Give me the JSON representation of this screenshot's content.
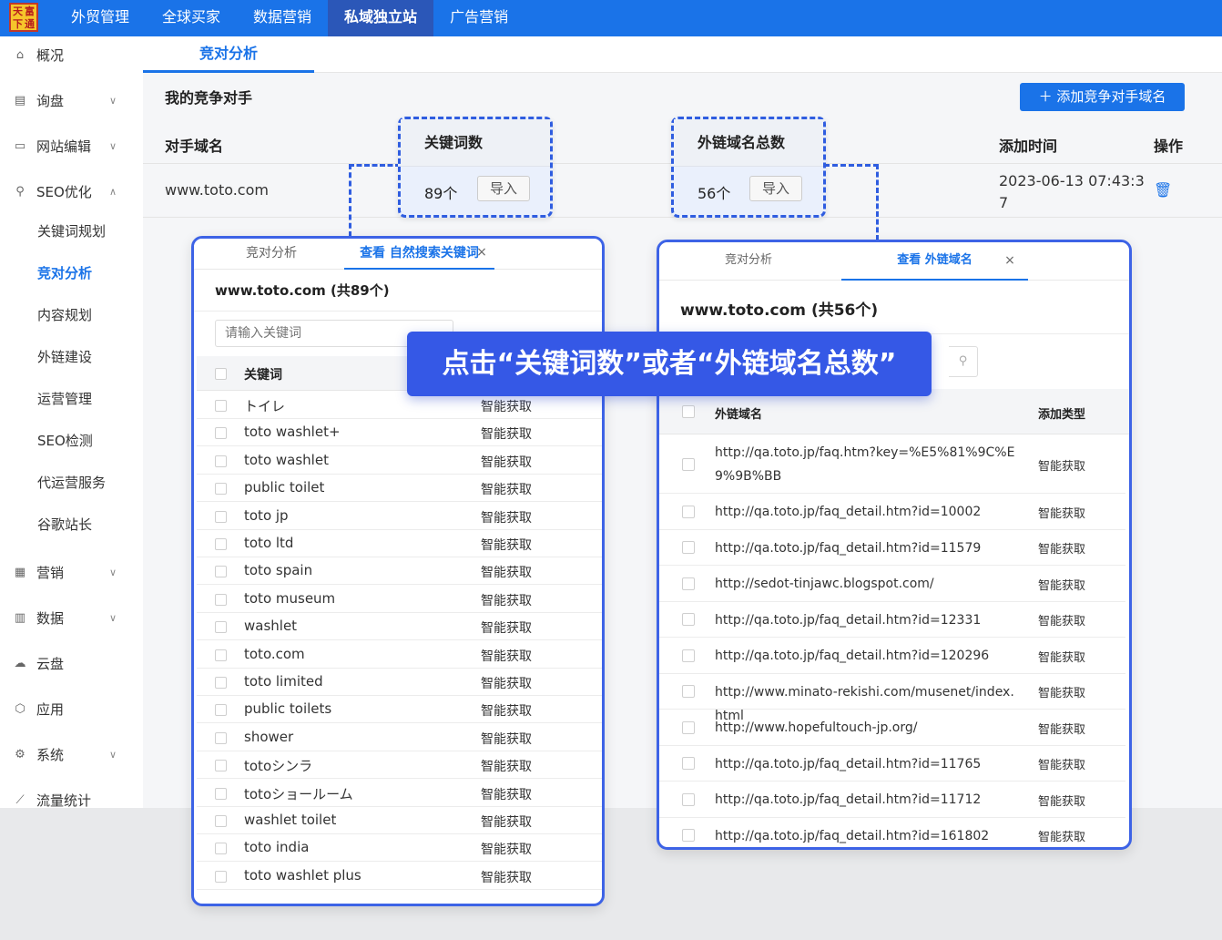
{
  "topbar": {
    "logo_chars": [
      "天",
      "富",
      "下",
      "通"
    ],
    "tabs": [
      {
        "label": "外贸管理",
        "active": false
      },
      {
        "label": "全球买家",
        "active": false
      },
      {
        "label": "数据营销",
        "active": false
      },
      {
        "label": "私域独立站",
        "active": true
      },
      {
        "label": "广告营销",
        "active": false
      }
    ]
  },
  "sidebar": {
    "items": [
      {
        "label": "概况",
        "icon": "home-icon",
        "glyph": "⌂"
      },
      {
        "label": "询盘",
        "icon": "clipboard-icon",
        "glyph": "▤",
        "chevron": "∨"
      },
      {
        "label": "网站编辑",
        "icon": "monitor-icon",
        "glyph": "▭",
        "chevron": "∨"
      },
      {
        "label": "SEO优化",
        "icon": "search-icon",
        "glyph": "⚲",
        "chevron": "∧"
      },
      {
        "label": "营销",
        "icon": "marketing-icon",
        "glyph": "▦",
        "chevron": "∨"
      },
      {
        "label": "数据",
        "icon": "data-icon",
        "glyph": "▥",
        "chevron": "∨"
      },
      {
        "label": "云盘",
        "icon": "cloud-icon",
        "glyph": "☁"
      },
      {
        "label": "应用",
        "icon": "app-icon",
        "glyph": "⬡"
      },
      {
        "label": "系统",
        "icon": "settings-icon",
        "glyph": "⚙",
        "chevron": "∨"
      },
      {
        "label": "流量统计",
        "icon": "chart-icon",
        "glyph": "⟋"
      }
    ],
    "sub_items": [
      {
        "label": "关键词规划",
        "active": false
      },
      {
        "label": "竞对分析",
        "active": true
      },
      {
        "label": "内容规划",
        "active": false
      },
      {
        "label": "外链建设",
        "active": false
      },
      {
        "label": "运营管理",
        "active": false
      },
      {
        "label": "SEO检测",
        "active": false
      },
      {
        "label": "代运营服务",
        "active": false
      },
      {
        "label": "谷歌站长",
        "active": false
      }
    ]
  },
  "main": {
    "tab": "竞对分析",
    "title": "我的竞争对手",
    "add_button": "添加竞争对手域名",
    "add_glyph": "＋",
    "columns": {
      "domain": "对手域名",
      "added_time": "添加时间",
      "actions": "操作"
    },
    "row": {
      "domain": "www.toto.com",
      "added_time": "2023-06-13 07:43:37",
      "trash_glyph": "🗑"
    }
  },
  "callouts": {
    "keywords": {
      "header": "关键词数",
      "value": "89个",
      "import_label": "导入"
    },
    "backlinks": {
      "header": "外链域名总数",
      "value": "56个",
      "import_label": "导入"
    }
  },
  "keyword_panel": {
    "tabs": [
      "竞对分析",
      "查看 自然搜索关键词"
    ],
    "close_glyph": "×",
    "title": "www.toto.com (共89个)",
    "search_placeholder": "请输入关键词",
    "columns": {
      "keyword": "关键词"
    },
    "rows": [
      {
        "keyword": "トイレ",
        "source": "智能获取"
      },
      {
        "keyword": "toto washlet+",
        "source": "智能获取"
      },
      {
        "keyword": "toto washlet",
        "source": "智能获取"
      },
      {
        "keyword": "public toilet",
        "source": "智能获取"
      },
      {
        "keyword": "toto jp",
        "source": "智能获取"
      },
      {
        "keyword": "toto ltd",
        "source": "智能获取"
      },
      {
        "keyword": "toto spain",
        "source": "智能获取"
      },
      {
        "keyword": "toto museum",
        "source": "智能获取"
      },
      {
        "keyword": "washlet",
        "source": "智能获取"
      },
      {
        "keyword": "toto.com",
        "source": "智能获取"
      },
      {
        "keyword": "toto limited",
        "source": "智能获取"
      },
      {
        "keyword": "public toilets",
        "source": "智能获取"
      },
      {
        "keyword": "shower",
        "source": "智能获取"
      },
      {
        "keyword": "totoシンラ",
        "source": "智能获取"
      },
      {
        "keyword": "totoショールーム",
        "source": "智能获取"
      },
      {
        "keyword": "washlet toilet",
        "source": "智能获取"
      },
      {
        "keyword": "toto india",
        "source": "智能获取"
      },
      {
        "keyword": "toto washlet plus",
        "source": "智能获取"
      }
    ]
  },
  "backlink_panel": {
    "tabs": [
      "竞对分析",
      "查看 外链域名"
    ],
    "close_glyph": "×",
    "title": "www.toto.com (共56个)",
    "columns": {
      "domain": "外链域名",
      "type": "添加类型"
    },
    "rows": [
      {
        "url": "http://qa.toto.jp/faq.htm?key=%E5%81%9C%E9%9B%BB",
        "type": "智能获取"
      },
      {
        "url": "http://qa.toto.jp/faq_detail.htm?id=10002",
        "type": "智能获取"
      },
      {
        "url": "http://qa.toto.jp/faq_detail.htm?id=11579",
        "type": "智能获取"
      },
      {
        "url": "http://sedot-tinjawc.blogspot.com/",
        "type": "智能获取"
      },
      {
        "url": "http://qa.toto.jp/faq_detail.htm?id=12331",
        "type": "智能获取"
      },
      {
        "url": "http://qa.toto.jp/faq_detail.htm?id=120296",
        "type": "智能获取"
      },
      {
        "url": "http://www.minato-rekishi.com/musenet/index.html",
        "type": "智能获取"
      },
      {
        "url": "http://www.hopefultouch-jp.org/",
        "type": "智能获取"
      },
      {
        "url": "http://qa.toto.jp/faq_detail.htm?id=11765",
        "type": "智能获取"
      },
      {
        "url": "http://qa.toto.jp/faq_detail.htm?id=11712",
        "type": "智能获取"
      },
      {
        "url": "http://qa.toto.jp/faq_detail.htm?id=161802",
        "type": "智能获取"
      }
    ]
  },
  "banner": "点击“关键词数”或者“外链域名总数”",
  "colors": {
    "primary": "#1a73e8",
    "highlight": "#3558e6"
  }
}
